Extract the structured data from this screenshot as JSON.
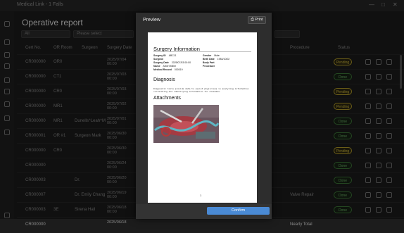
{
  "window": {
    "title": "Medical Link - 1 Falls",
    "controls": [
      "—",
      "□",
      "✕"
    ]
  },
  "page": {
    "title": "Operative report"
  },
  "filters": {
    "first": "All",
    "second": "Please select"
  },
  "table": {
    "headers": [
      "Cert No.",
      "OR Room",
      "Surgeon",
      "Surgery Date",
      "Procedure",
      "Status"
    ],
    "rows": [
      {
        "cert": "CR000000",
        "room": "OR0",
        "surgeon": "",
        "date": "2025/07/04",
        "time": "00:00",
        "procedure": "",
        "status": "Pending"
      },
      {
        "cert": "CR000000",
        "room": "CT1",
        "surgeon": "",
        "date": "2025/07/03",
        "time": "00:00",
        "procedure": "",
        "status": "Done"
      },
      {
        "cert": "CR000000",
        "room": "CR0",
        "surgeon": "",
        "date": "2025/07/03",
        "time": "00:00",
        "procedure": "",
        "status": "Pending"
      },
      {
        "cert": "CR000000",
        "room": "MR1",
        "surgeon": "",
        "date": "2025/07/02",
        "time": "00:00",
        "procedure": "",
        "status": "Pending"
      },
      {
        "cert": "CR000000",
        "room": "MR1",
        "surgeon": "Dunells^Leah^M",
        "date": "2025/07/01",
        "time": "00:00",
        "procedure": "",
        "status": "Done"
      },
      {
        "cert": "CR000001",
        "room": "OR #1",
        "surgeon": "Surgeon Mark",
        "date": "2025/06/30",
        "time": "00:00",
        "procedure": "",
        "status": "Done"
      },
      {
        "cert": "CR000000",
        "room": "CR0",
        "surgeon": "",
        "date": "2025/06/30",
        "time": "00:00",
        "procedure": "",
        "status": "Pending"
      },
      {
        "cert": "CR000000",
        "room": "",
        "surgeon": "",
        "date": "2025/06/24",
        "time": "00:00",
        "procedure": "",
        "status": "Done"
      },
      {
        "cert": "CR000003",
        "room": "",
        "surgeon": "Dr.",
        "date": "2025/06/20",
        "time": "00:00",
        "procedure": "",
        "status": "Done"
      },
      {
        "cert": "CR000007",
        "room": "",
        "surgeon": "Dr. Emily Chang",
        "date": "2025/06/19",
        "time": "00:00",
        "procedure": "Valve Repair",
        "status": "Done"
      },
      {
        "cert": "CR000003",
        "room": "3E",
        "surgeon": "Sirena Hall",
        "date": "2025/06/18",
        "time": "00:00",
        "procedure": "",
        "status": "Done"
      },
      {
        "cert": "CR000000",
        "room": "",
        "surgeon": "",
        "date": "2025/06/18",
        "time": "",
        "procedure": "Nearly Total",
        "status": ""
      }
    ]
  },
  "modal": {
    "title": "Preview",
    "print_label": "Print",
    "confirm_label": "Confirm",
    "doc": {
      "heading": "Surgery Information",
      "fields_left": [
        {
          "k": "Surgery ID",
          "v": "ABC11"
        },
        {
          "k": "Surgeon",
          "v": ""
        },
        {
          "k": "Surgery Date",
          "v": "2025/07/03 00:00"
        },
        {
          "k": "Name",
          "v": "Albert Miller"
        },
        {
          "k": "Medical Record",
          "v": "000019"
        }
      ],
      "fields_right": [
        {
          "k": "Gender",
          "v": "Male"
        },
        {
          "k": "Birth Date",
          "v": "1984/10/02"
        },
        {
          "k": "Body Part",
          "v": ""
        },
        {
          "k": "Procedure",
          "v": ""
        }
      ],
      "diagnosis_heading": "Diagnosis",
      "diagnosis_text": "Diagnostic tools provide data to assist physicians in analyzing information correlating and identifying information for diseases.",
      "attachments_heading": "Attachments",
      "page_number": "1"
    }
  },
  "colors": {
    "pending": "#d8c040",
    "done": "#6fb66a",
    "accent": "#4a8ad4"
  }
}
